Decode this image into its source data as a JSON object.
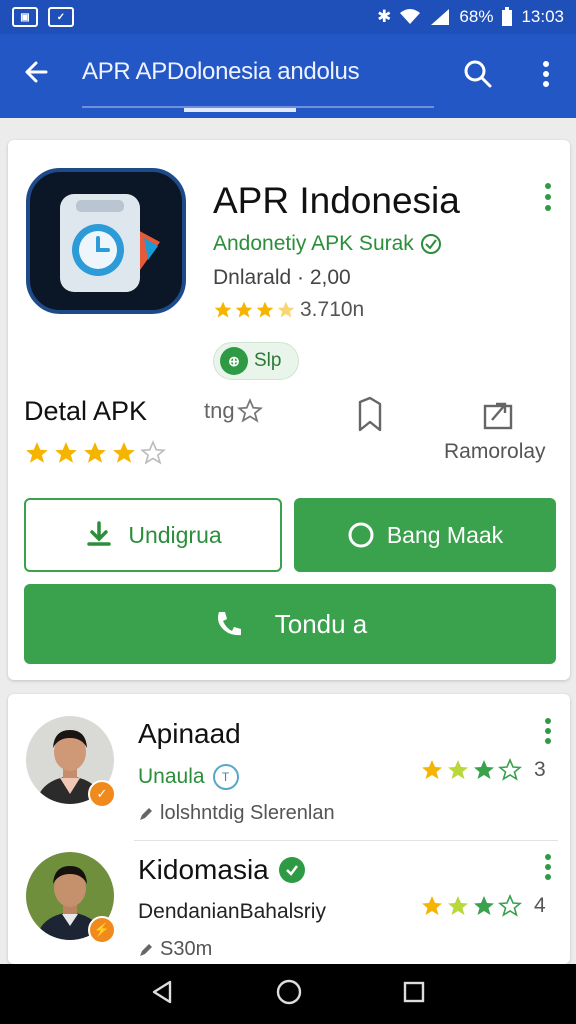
{
  "status_bar": {
    "left_icons": [
      "photo-icon",
      "message-icon"
    ],
    "battery_text": "68%",
    "time": "13:03"
  },
  "app_bar": {
    "title": "APR APDolonesia andolus"
  },
  "app_card": {
    "name": "APR Indonesia",
    "developer": "Andonetiy APK Surak",
    "downloads": "Dnlarald · 2,00",
    "rating_text": "3.710n",
    "stars": 3.5,
    "chip_label": "Slp",
    "chip_icon_text": "⊕",
    "detail_label": "Detal APK",
    "detail_stars": 4,
    "rate_label": "tng",
    "replay_label": "Ramorolay",
    "btn_outline_label": "Undigrua",
    "btn_green_label": "Bang Maak",
    "btn_big_label": "Tondu a",
    "colors": {
      "accent": "#3aa14c",
      "primary": "#2457c6",
      "star": "#f4b400"
    }
  },
  "list": [
    {
      "name": "Apinaad",
      "subtitle": "Unaula",
      "subtitle_badge": "T",
      "meta": "lolshntdig Slerenlan",
      "stars": 3,
      "count": "3"
    },
    {
      "name": "Kidomasia",
      "subtitle": "DendanianBahalsriy",
      "meta": "S30m",
      "stars": 3,
      "count": "4"
    }
  ]
}
